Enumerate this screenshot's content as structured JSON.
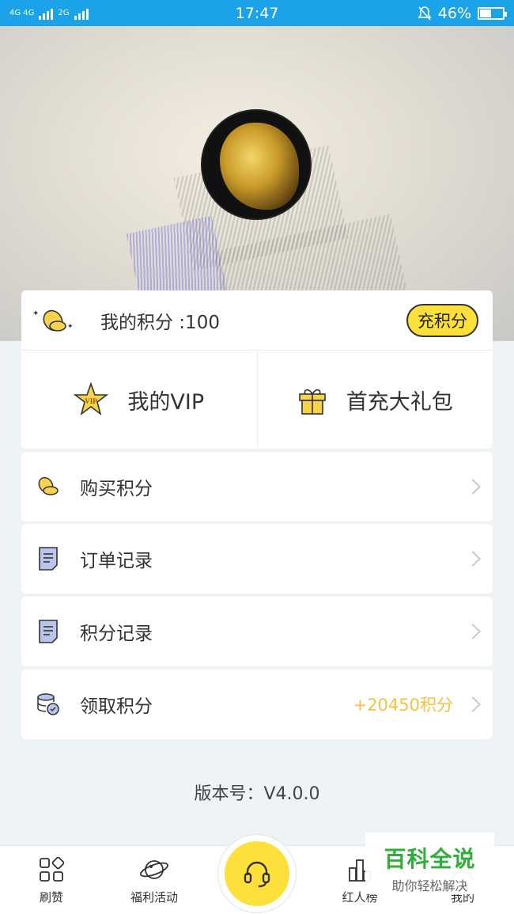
{
  "status_bar": {
    "network_left": "4G 4G",
    "network_right": "2G",
    "time": "17:47",
    "battery": "46%",
    "battery_level": 0.46
  },
  "points": {
    "label": "我的积分 :100",
    "recharge_button": "充积分"
  },
  "quick_actions": [
    {
      "label": "我的VIP",
      "icon": "vip-star-icon"
    },
    {
      "label": "首充大礼包",
      "icon": "gift-icon"
    }
  ],
  "menu": [
    {
      "label": "购买积分",
      "icon": "coins-icon",
      "extra": ""
    },
    {
      "label": "订单记录",
      "icon": "document-icon",
      "extra": ""
    },
    {
      "label": "积分记录",
      "icon": "document-icon",
      "extra": ""
    },
    {
      "label": "领取积分",
      "icon": "coin-stack-icon",
      "extra": "+20450积分"
    }
  ],
  "version": "版本号：V4.0.0",
  "bottom_nav": [
    {
      "label": "刷赞",
      "icon": "grid-icon"
    },
    {
      "label": "福利活动",
      "icon": "planet-icon"
    },
    {
      "label": "",
      "icon": "headset-icon"
    },
    {
      "label": "红人榜",
      "icon": "ranking-icon"
    },
    {
      "label": "我的",
      "icon": "profile-icon"
    }
  ],
  "watermark": {
    "title": "百科全说",
    "subtitle": "助你轻松解决"
  },
  "colors": {
    "status_bar": "#1aa3e8",
    "accent_yellow": "#fde03a",
    "points_orange": "#f2c340",
    "watermark_green": "#2fae3a"
  }
}
